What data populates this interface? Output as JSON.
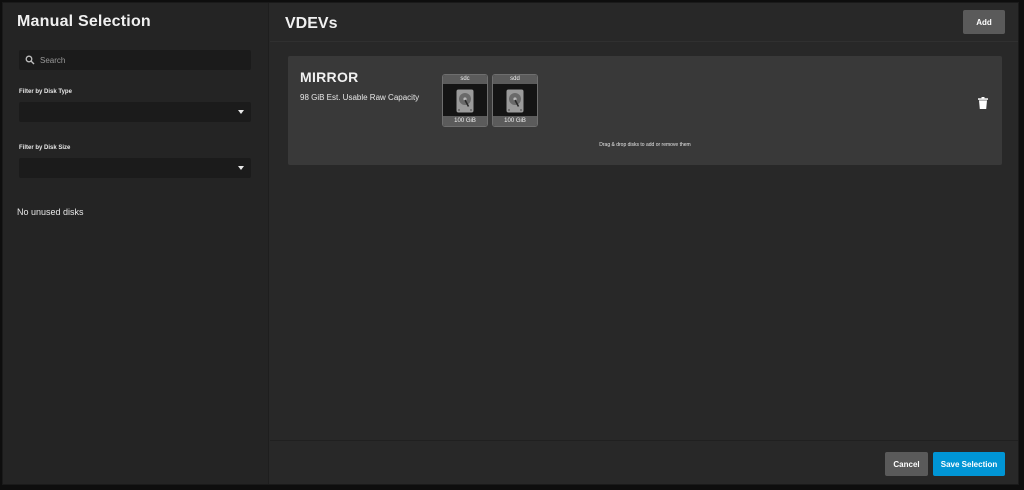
{
  "left_pane": {
    "title": "Manual Selection",
    "search": {
      "placeholder": "Search",
      "value": ""
    },
    "filters": [
      {
        "label": "Filter by Disk Type",
        "value": ""
      },
      {
        "label": "Filter by Disk Size",
        "value": ""
      }
    ],
    "empty_message": "No unused disks"
  },
  "right_pane": {
    "title": "VDEVs",
    "add_label": "Add",
    "vdev": {
      "type": "MIRROR",
      "capacity": "98 GiB Est. Usable Raw Capacity",
      "disks": [
        {
          "name": "sdc",
          "size": "100 GiB",
          "icon": "hard-disk-icon"
        },
        {
          "name": "sdd",
          "size": "100 GiB",
          "icon": "hard-disk-icon"
        }
      ],
      "drag_hint": "Drag & drop disks to add or remove them",
      "delete_icon": "trash-icon"
    }
  },
  "footer": {
    "cancel_label": "Cancel",
    "save_label": "Save Selection"
  },
  "colors": {
    "background": "#282828",
    "panel": "#242424",
    "card": "#393939",
    "primary": "#0095d5",
    "secondary_button": "#5a5a5a"
  }
}
